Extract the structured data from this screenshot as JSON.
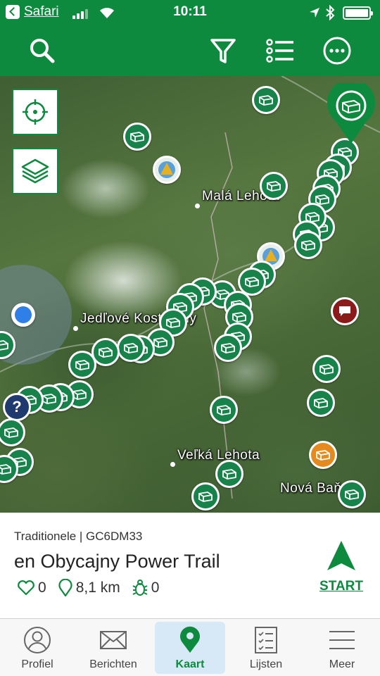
{
  "status_bar": {
    "app_label": "Safari",
    "time": "10:11"
  },
  "toolbar": {
    "search_icon": "search-icon",
    "filter_icon": "filter-icon",
    "list_icon": "list-icon",
    "more_icon": "more-icon"
  },
  "map": {
    "places": [
      "Malá Lehota",
      "Jedľové Kostoľany",
      "Veľká Lehota",
      "Nová Baňa"
    ],
    "marker_color": "#17824a",
    "accent_color": "#0e8a3f"
  },
  "cache_card": {
    "meta": "Traditionele | GC6DM33",
    "title": "en Obycajny Power Trail",
    "favorites": "0",
    "distance": "8,1 km",
    "trackables": "0",
    "start_label": "START"
  },
  "tabs": [
    {
      "label": "Profiel",
      "icon": "profile-icon"
    },
    {
      "label": "Berichten",
      "icon": "mail-icon"
    },
    {
      "label": "Kaart",
      "icon": "map-pin-icon",
      "active": true
    },
    {
      "label": "Lijsten",
      "icon": "checklist-icon"
    },
    {
      "label": "Meer",
      "icon": "menu-icon"
    }
  ]
}
